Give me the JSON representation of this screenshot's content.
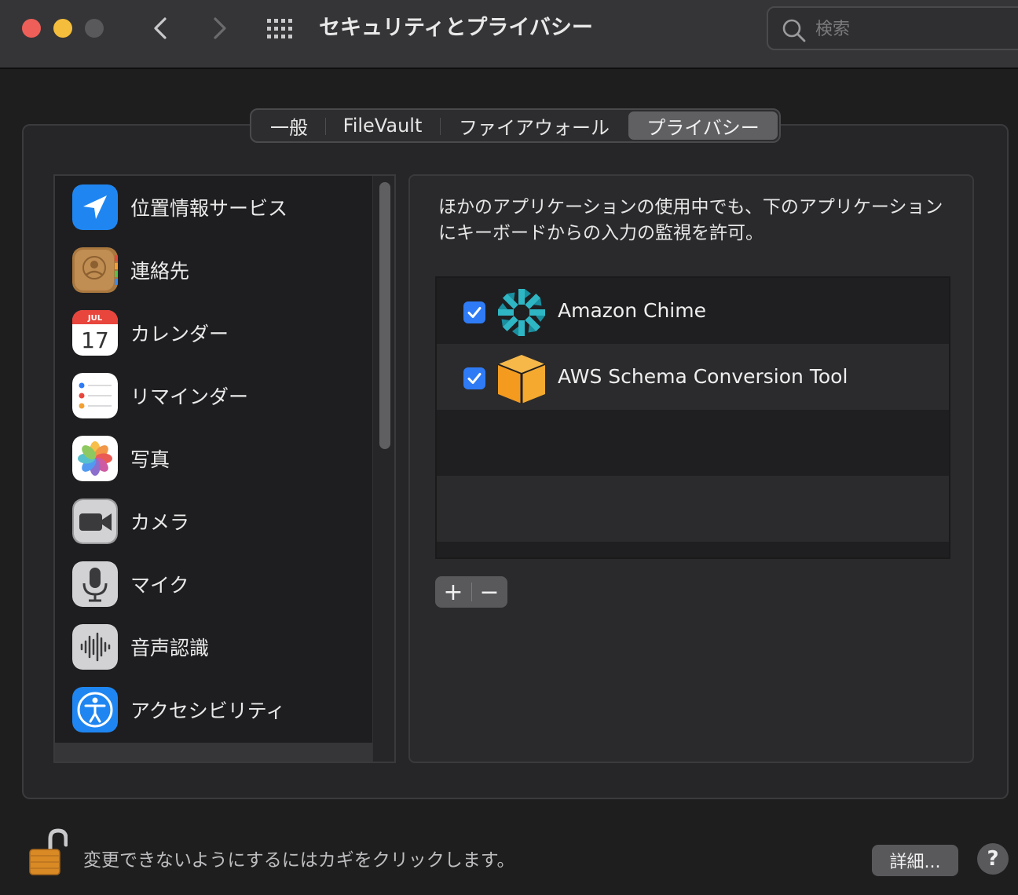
{
  "window": {
    "title": "セキュリティとプライバシー",
    "search_placeholder": "検索"
  },
  "tabs": [
    {
      "label": "一般",
      "active": false
    },
    {
      "label": "FileVault",
      "active": false
    },
    {
      "label": "ファイアウォール",
      "active": false
    },
    {
      "label": "プライバシー",
      "active": true
    }
  ],
  "sidebar": {
    "items": [
      {
        "label": "位置情報サービス",
        "icon": "location-arrow-icon"
      },
      {
        "label": "連絡先",
        "icon": "contacts-icon"
      },
      {
        "label": "カレンダー",
        "icon": "calendar-icon",
        "calendar_month": "JUL",
        "calendar_day": "17"
      },
      {
        "label": "リマインダー",
        "icon": "reminders-icon"
      },
      {
        "label": "写真",
        "icon": "photos-icon"
      },
      {
        "label": "カメラ",
        "icon": "camera-icon"
      },
      {
        "label": "マイク",
        "icon": "microphone-icon"
      },
      {
        "label": "音声認識",
        "icon": "speech-recognition-icon"
      },
      {
        "label": "アクセシビリティ",
        "icon": "accessibility-icon"
      }
    ]
  },
  "main": {
    "description": "ほかのアプリケーションの使用中でも、下のアプリケーションにキーボードからの入力の監視を許可。",
    "apps": [
      {
        "name": "Amazon Chime",
        "checked": true,
        "icon": "amazon-chime-icon"
      },
      {
        "name": "AWS Schema Conversion Tool",
        "checked": true,
        "icon": "aws-sct-icon"
      }
    ],
    "add_label": "+",
    "remove_label": "−"
  },
  "footer": {
    "lock_text": "変更できないようにするにはカギをクリックします。",
    "details_label": "詳細...",
    "help_label": "?"
  },
  "colors": {
    "accent": "#2f7bf5",
    "close": "#ed5f58",
    "minimize": "#f4bd3b"
  }
}
